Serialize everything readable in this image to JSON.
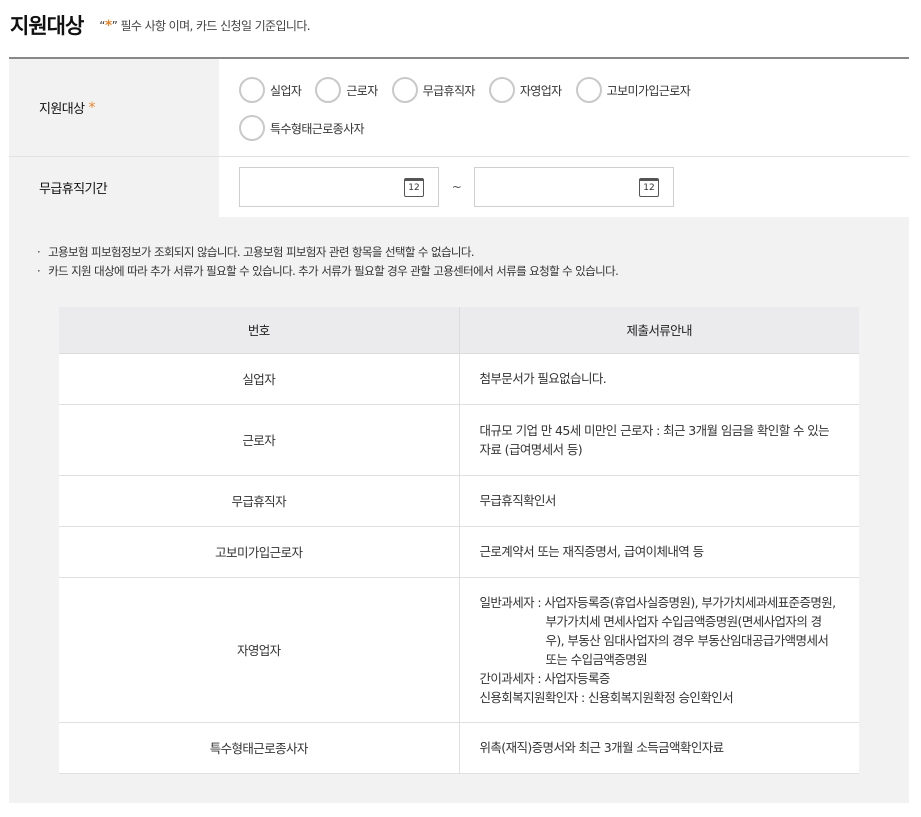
{
  "header": {
    "title": "지원대상",
    "note_open": "“",
    "note_star": "*",
    "note_close": "”",
    "note_text": " 필수 사항 이며, 카드 신청일 기준입니다."
  },
  "form": {
    "target": {
      "label": "지원대상",
      "star": "*",
      "options": [
        "실업자",
        "근로자",
        "무급휴직자",
        "자영업자",
        "고보미가입근로자",
        "특수형태근로종사자"
      ]
    },
    "period": {
      "label": "무급휴직기간",
      "start_value": "",
      "end_value": "",
      "separator": "~",
      "calendar_glyph": "12"
    }
  },
  "notes": [
    "고용보험 피보험정보가 조회되지 않습니다. 고용보험 피보험자 관련 항목을 선택할 수 없습니다.",
    "카드 지원 대상에 따라 추가 서류가 필요할 수 있습니다. 추가 서류가 필요할 경우 관할 고용센터에서 서류를 요청할 수 있습니다."
  ],
  "table": {
    "headers": [
      "번호",
      "제출서류안내"
    ],
    "rows": [
      {
        "name": "실업자",
        "doc": [
          "첨부문서가 필요없습니다."
        ]
      },
      {
        "name": "근로자",
        "doc": [
          "대규모 기업 만 45세 미만인 근로자 : 최근 3개월 임금을 확인할 수 있는 자료 (급여명세서 등)"
        ]
      },
      {
        "name": "무급휴직자",
        "doc": [
          "무급휴직확인서"
        ]
      },
      {
        "name": "고보미가입근로자",
        "doc": [
          "근로계약서 또는 재직증명서, 급여이체내역 등"
        ]
      },
      {
        "name": "자영업자",
        "doc": [
          "일반과세자 : 사업자등록증(휴업사실증명원), 부가가치세과세표준증명원, 부가가치세 면세사업자 수입금액증명원(면세사업자의 경우), 부동산 임대사업자의 경우 부동산임대공급가액명세서 또는 수입금액증명원",
          "간이과세자 : 사업자등록증",
          "신용회복지원확인자 : 신용회복지원확정 승인확인서"
        ]
      },
      {
        "name": "특수형태근로종사자",
        "doc": [
          "위촉(재직)증명서와 최근 3개월 소득금액확인자료"
        ]
      }
    ]
  }
}
